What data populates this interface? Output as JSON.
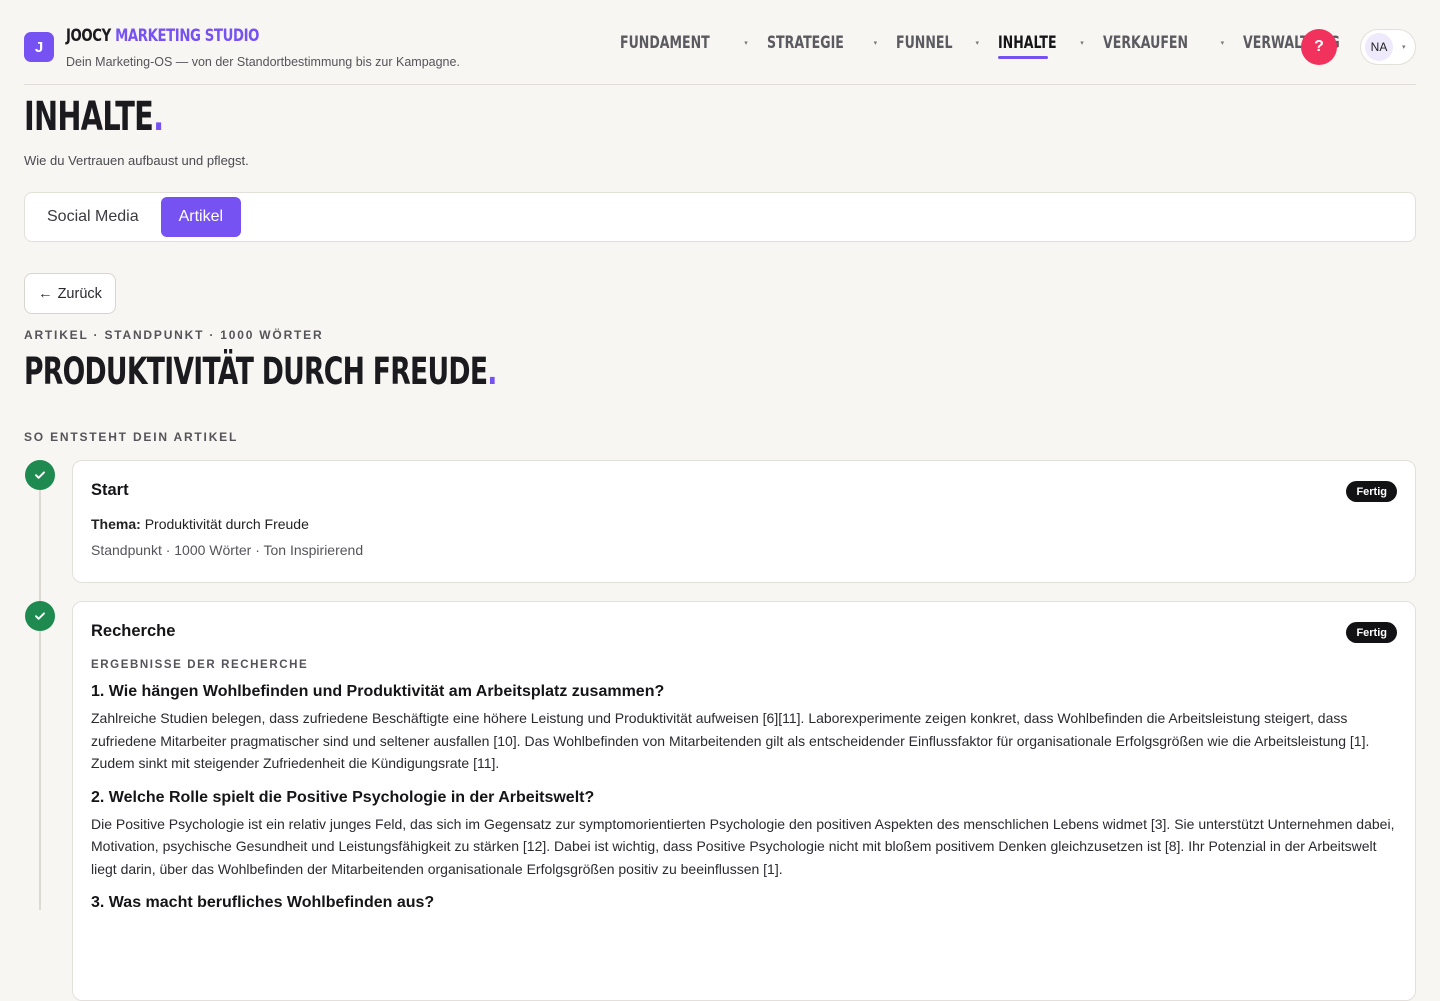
{
  "app": {
    "logo_letter": "J",
    "brand_prefix": "JOOCY",
    "brand_accent": "MARKETING STUDIO",
    "tagline": "Dein Marketing-OS — von der Standortbestimmung bis zur Kampagne."
  },
  "nav": {
    "items": [
      {
        "label": "FUNDAMENT",
        "active": false
      },
      {
        "label": "STRATEGIE",
        "active": false
      },
      {
        "label": "FUNNEL",
        "active": false
      },
      {
        "label": "INHALTE",
        "active": true
      },
      {
        "label": "VERKAUFEN",
        "active": false
      },
      {
        "label": "VERWALTUNG",
        "active": false
      }
    ],
    "caret": "▾"
  },
  "header": {
    "help_label": "?",
    "user_initials": "NA"
  },
  "page": {
    "title": "INHALTE",
    "title_dot": ".",
    "subtitle": "Wie du Vertrauen aufbaust und pflegst."
  },
  "tabs": [
    {
      "label": "Social Media",
      "active": false
    },
    {
      "label": "Artikel",
      "active": true
    }
  ],
  "back_button": {
    "arrow": "←",
    "label": "Zurück"
  },
  "article": {
    "eyebrow": "ARTIKEL · STANDPUNKT · 1000 WÖRTER",
    "title": "PRODUKTIVITÄT DURCH FREUDE",
    "title_dot": "."
  },
  "process": {
    "section_label": "SO ENTSTEHT DEIN ARTIKEL",
    "steps": [
      {
        "title": "Start",
        "status": "Fertig",
        "thema_label": "Thema:",
        "thema_value": "Produktivität durch Freude",
        "meta": "Standpunkt · 1000 Wörter · Ton Inspirierend"
      },
      {
        "title": "Recherche",
        "status": "Fertig",
        "results_label": "ERGEBNISSE DER RECHERCHE",
        "questions": [
          {
            "title": "1. Wie hängen Wohlbefinden und Produktivität am Arbeitsplatz zusammen?",
            "body": "Zahlreiche Studien belegen, dass zufriedene Beschäftigte eine höhere Leistung und Produktivität aufweisen [6][11]. Laborexperimente zeigen konkret, dass Wohlbefinden die Arbeitsleistung steigert, dass zufriedene Mitarbeiter pragmatischer sind und seltener ausfallen [10]. Das Wohlbefinden von Mitarbeitenden gilt als entscheidender Einflussfaktor für organisationale Erfolgsgrößen wie die Arbeitsleistung [1]. Zudem sinkt mit steigender Zufriedenheit die Kündigungsrate [11]."
          },
          {
            "title": "2. Welche Rolle spielt die Positive Psychologie in der Arbeitswelt?",
            "body": "Die Positive Psychologie ist ein relativ junges Feld, das sich im Gegensatz zur symptomorientierten Psychologie den positiven Aspekten des menschlichen Lebens widmet [3]. Sie unterstützt Unternehmen dabei, Motivation, psychische Gesundheit und Leistungsfähigkeit zu stärken [12]. Dabei ist wichtig, dass Positive Psychologie nicht mit bloßem positivem Denken gleichzusetzen ist [8]. Ihr Potenzial in der Arbeitswelt liegt darin, über das Wohlbefinden der Mitarbeitenden organisationale Erfolgsgrößen positiv zu beeinflussen [1]."
          },
          {
            "title": "3. Was macht berufliches Wohlbefinden aus?",
            "body": ""
          }
        ]
      }
    ]
  },
  "colors": {
    "accent": "#7652f2",
    "background": "#f8f6f2",
    "success": "#1f8a50",
    "help": "#f0325d",
    "badge": "#121214"
  }
}
